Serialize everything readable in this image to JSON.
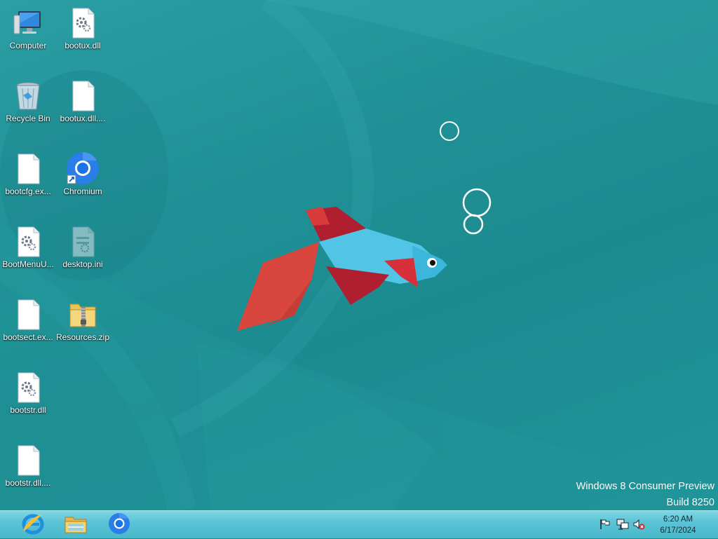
{
  "desktop": {
    "icons": [
      {
        "label": "Computer",
        "icon": "computer-icon"
      },
      {
        "label": "bootux.dll",
        "icon": "dll-file-icon"
      },
      {
        "label": "Recycle Bin",
        "icon": "recycle-bin-icon"
      },
      {
        "label": "bootux.dll....",
        "icon": "blank-file-icon"
      },
      {
        "label": "bootcfg.ex...",
        "icon": "blank-file-icon"
      },
      {
        "label": "Chromium",
        "icon": "chromium-shortcut-icon"
      },
      {
        "label": "BootMenuU...",
        "icon": "dll-file-icon"
      },
      {
        "label": "desktop.ini",
        "icon": "ini-file-icon"
      },
      {
        "label": "bootsect.ex...",
        "icon": "blank-file-icon"
      },
      {
        "label": "Resources.zip",
        "icon": "zip-folder-icon"
      },
      {
        "label": "bootstr.dll",
        "icon": "dll-file-icon"
      },
      {
        "label": "bootstr.dll....",
        "icon": "blank-file-icon"
      }
    ],
    "wallpaper": "betta-fish-wallpaper"
  },
  "watermark": {
    "line1": "Windows 8 Consumer Preview",
    "line2": "Build 8250"
  },
  "taskbar": {
    "pinned": [
      {
        "name": "Internet Explorer",
        "icon": "internet-explorer-icon"
      },
      {
        "name": "File Explorer",
        "icon": "file-explorer-icon"
      },
      {
        "name": "Chromium",
        "icon": "chromium-icon"
      }
    ],
    "tray": {
      "icons": [
        "action-center-flag-icon",
        "network-icon",
        "volume-muted-icon"
      ],
      "time": "6:20 AM",
      "date": "6/17/2024"
    }
  },
  "colors": {
    "desktop_background": "#1f8e93",
    "taskbar": "#5cc3d5",
    "fish_body": "#4fc3e3",
    "fish_fins": "#c8283a"
  }
}
